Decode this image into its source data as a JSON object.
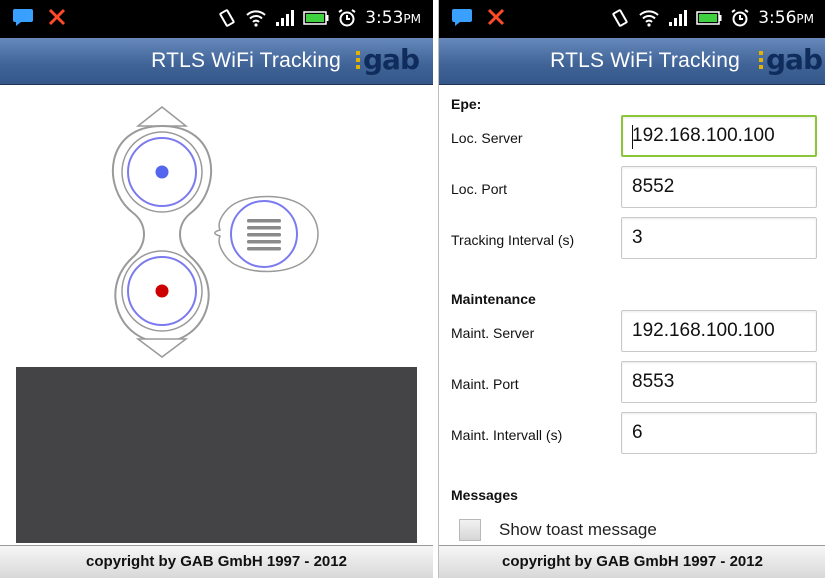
{
  "screens": [
    {
      "status": {
        "time": "3:53",
        "ampm": "PM"
      },
      "app_title": "RTLS WiFi Tracking",
      "logo": "gab",
      "footer": "copyright by GAB GmbH 1997 - 2012",
      "controller": {
        "up_icon": "chevron-up-icon",
        "top_button_color": "#5566ee",
        "bottom_button_color": "#cc0000",
        "menu_icon": "menu-lines-icon",
        "down_icon": "chevron-down-icon"
      }
    },
    {
      "status": {
        "time": "3:56",
        "ampm": "PM"
      },
      "app_title": "RTLS WiFi Tracking",
      "logo": "gab",
      "footer": "copyright by GAB GmbH 1997 - 2012",
      "sections": {
        "epe": "Epe:",
        "maintenance": "Maintenance",
        "messages": "Messages"
      },
      "fields": {
        "loc_server": {
          "label": "Loc. Server",
          "value": "192.168.100.100"
        },
        "loc_port": {
          "label": "Loc. Port",
          "value": "8552"
        },
        "tracking_interval": {
          "label": "Tracking Interval (s)",
          "value": "3"
        },
        "maint_server": {
          "label": "Maint. Server",
          "value": "192.168.100.100"
        },
        "maint_port": {
          "label": "Maint. Port",
          "value": "8553"
        },
        "maint_interval": {
          "label": "Maint. Intervall (s)",
          "value": "6"
        }
      },
      "toast_checkbox": {
        "label": "Show toast message",
        "checked": false
      }
    }
  ],
  "colors": {
    "appbar": "#3f6396",
    "focus_border": "#8cc43a",
    "logo_accent": "#e0b400"
  }
}
